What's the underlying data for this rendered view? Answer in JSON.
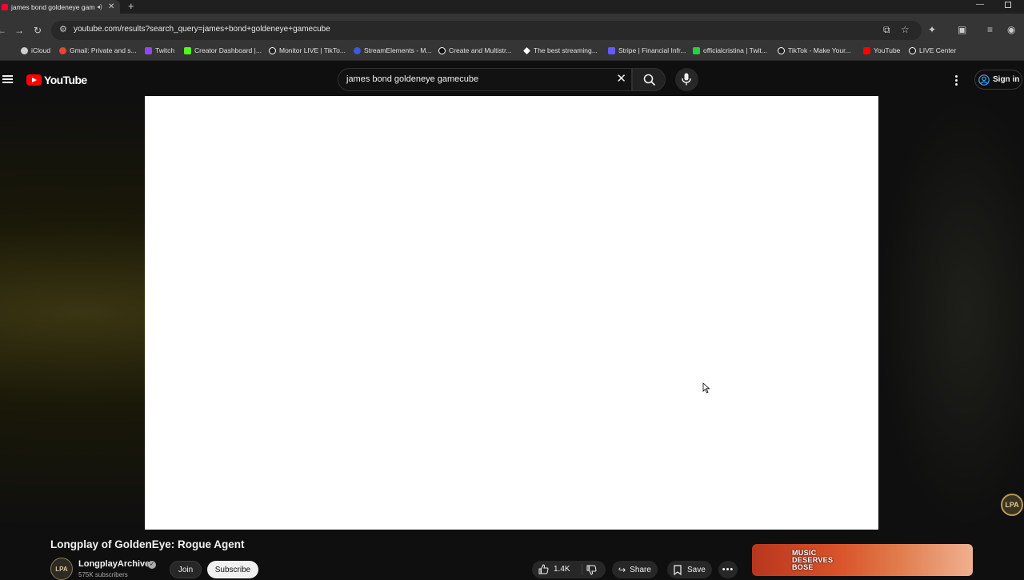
{
  "browser": {
    "tab_title": "james bond goldeneye gam",
    "url": "youtube.com/results?search_query=james+bond+goldeneye+gamecube",
    "bookmarks": [
      {
        "label": "iCloud",
        "color": "#cfcfcf"
      },
      {
        "label": "Gmail: Private and s...",
        "color": "#ea4335"
      },
      {
        "label": "Twitch",
        "color": "#9146ff"
      },
      {
        "label": "Creator Dashboard |...",
        "color": "#53fc18"
      },
      {
        "label": "Monitor LIVE | TikTo...",
        "color": "#ffffff"
      },
      {
        "label": "StreamElements - M...",
        "color": "#3b5bdb"
      },
      {
        "label": "Create and Multistr...",
        "color": "#ffffff"
      },
      {
        "label": "The best streaming...",
        "color": "#ffffff"
      },
      {
        "label": "Stripe | Financial Infr...",
        "color": "#635bff"
      },
      {
        "label": "officialcristina | Twit...",
        "color": "#2ecc40"
      },
      {
        "label": "TikTok - Make Your...",
        "color": "#ffffff"
      },
      {
        "label": "YouTube",
        "color": "#ff0000"
      },
      {
        "label": "LIVE Center",
        "color": "#ffffff"
      }
    ]
  },
  "youtube": {
    "logo_text": "YouTube",
    "search_query": "james bond goldeneye gamecube",
    "sign_in": "Sign in"
  },
  "video": {
    "title": "Longplay of GoldenEye: Rogue Agent",
    "channel_name": "LongplayArchive",
    "channel_avatar_text": "LPA",
    "subscribers": "575K subscribers",
    "join_label": "Join",
    "subscribe_label": "Subscribe",
    "like_count": "1.4K",
    "share_label": "Share",
    "save_label": "Save",
    "watermark_text": "LPA"
  },
  "ad": {
    "text_line1": "MUSIC",
    "text_line2": "DESERVES",
    "text_line3": "BOSE"
  }
}
